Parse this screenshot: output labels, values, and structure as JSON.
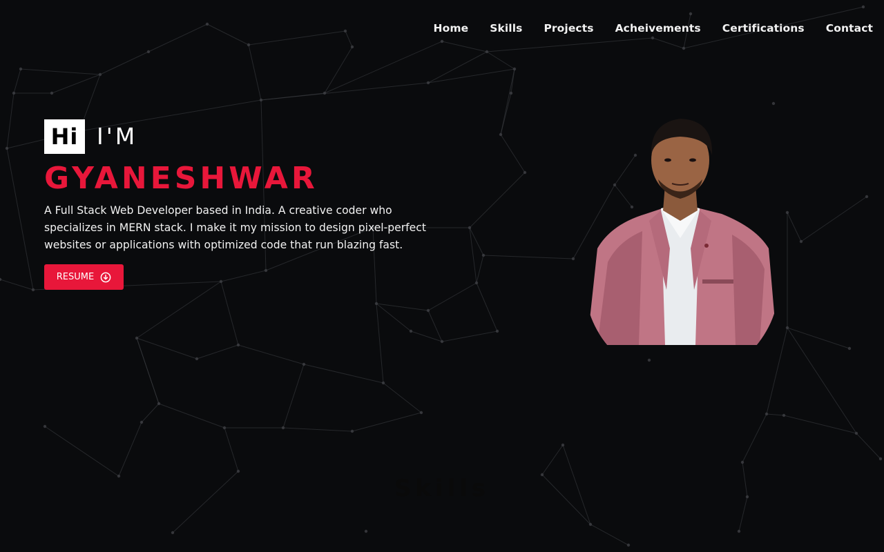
{
  "nav": {
    "items": [
      {
        "label": "Home"
      },
      {
        "label": "Skills"
      },
      {
        "label": "Projects"
      },
      {
        "label": "Acheivements"
      },
      {
        "label": "Certifications"
      },
      {
        "label": "Contact"
      }
    ]
  },
  "hero": {
    "hi_label": "Hi",
    "im_label": "I'M",
    "name": "GYANESHWAR",
    "description": "A Full Stack Web Developer based in India. A creative coder who specializes in MERN stack. I make it my mission to design pixel-perfect websites or applications with optimized code that run blazing fast.",
    "resume_label": "RESUME",
    "resume_icon": "download-circle-icon"
  },
  "skills": {
    "title": "Skills"
  },
  "colors": {
    "background": "#0a0b0d",
    "accent": "#e8173a",
    "text": "#f2f2f2"
  }
}
